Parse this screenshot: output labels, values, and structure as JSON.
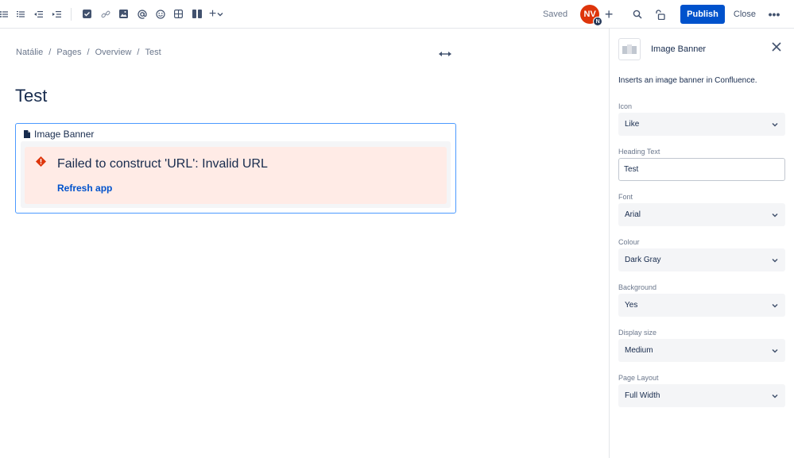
{
  "toolbar": {
    "saved_label": "Saved",
    "avatar_initials": "NV",
    "avatar_badge": "N",
    "publish_label": "Publish",
    "close_label": "Close",
    "more_label": "•••",
    "add_label": "+"
  },
  "breadcrumb": {
    "items": [
      "Natálie",
      "Pages",
      "Overview",
      "Test"
    ],
    "sep": "/"
  },
  "page": {
    "title": "Test"
  },
  "macro": {
    "header": "Image Banner",
    "error_title": "Failed to construct 'URL': Invalid URL",
    "error_link": "Refresh app"
  },
  "sidebar": {
    "title": "Image Banner",
    "description": "Inserts an image banner in Confluence.",
    "fields": {
      "icon": {
        "label": "Icon",
        "value": "Like"
      },
      "heading": {
        "label": "Heading Text",
        "value": "Test"
      },
      "font": {
        "label": "Font",
        "value": "Arial"
      },
      "colour": {
        "label": "Colour",
        "value": "Dark Gray"
      },
      "background": {
        "label": "Background",
        "value": "Yes"
      },
      "display_size": {
        "label": "Display size",
        "value": "Medium"
      },
      "page_layout": {
        "label": "Page Layout",
        "value": "Full Width"
      }
    }
  },
  "colors": {
    "accent": "#0052cc",
    "error_bg": "#ffebe6",
    "error_icon": "#de350b",
    "avatar": "#de350b"
  }
}
